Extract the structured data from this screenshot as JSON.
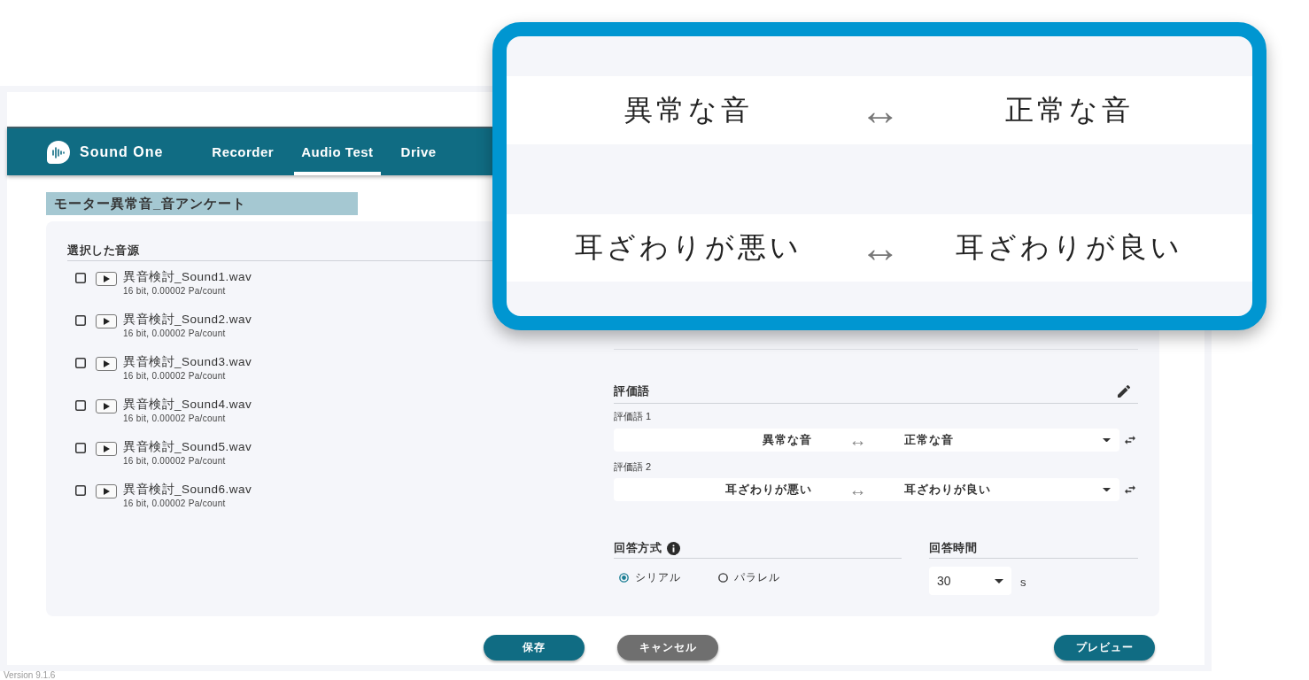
{
  "app": {
    "name": "Sound One"
  },
  "nav_tabs": [
    {
      "label": "Recorder",
      "selected": false
    },
    {
      "label": "Audio Test",
      "selected": true
    },
    {
      "label": "Drive",
      "selected": false
    }
  ],
  "page_title": "モーター異常音_音アンケート",
  "sound_sources": {
    "heading": "選択した音源",
    "items": [
      {
        "name": "異音検討_Sound1.wav",
        "detail": "16 bit, 0.00002 Pa/count",
        "checked": false
      },
      {
        "name": "異音検討_Sound2.wav",
        "detail": "16 bit, 0.00002 Pa/count",
        "checked": false
      },
      {
        "name": "異音検討_Sound3.wav",
        "detail": "16 bit, 0.00002 Pa/count",
        "checked": false
      },
      {
        "name": "異音検討_Sound4.wav",
        "detail": "16 bit, 0.00002 Pa/count",
        "checked": false
      },
      {
        "name": "異音検討_Sound5.wav",
        "detail": "16 bit, 0.00002 Pa/count",
        "checked": false
      },
      {
        "name": "異音検討_Sound6.wav",
        "detail": "16 bit, 0.00002 Pa/count",
        "checked": false
      }
    ]
  },
  "evaluation_words": {
    "heading": "評価語",
    "pairs": [
      {
        "label": "評価語 1",
        "negative": "異常な音",
        "arrow": "↔",
        "positive": "正常な音"
      },
      {
        "label": "評価語 2",
        "negative": "耳ざわりが悪い",
        "arrow": "↔",
        "positive": "耳ざわりが良い"
      }
    ]
  },
  "answer_method": {
    "heading": "回答方式",
    "options": [
      {
        "label": "シリアル",
        "selected": true
      },
      {
        "label": "パラレル",
        "selected": false
      }
    ]
  },
  "answer_time": {
    "heading": "回答時間",
    "value": "30",
    "unit": "s"
  },
  "buttons": [
    {
      "label": "保存",
      "kind": "primary"
    },
    {
      "label": "キャンセル",
      "kind": "secondary"
    }
  ],
  "preview_button": {
    "label": "プレビュー",
    "kind": "primary"
  },
  "zoom_callout": {
    "pairs": [
      {
        "negative": "異常な音",
        "arrow": "↔",
        "positive": "正常な音"
      },
      {
        "negative": "耳ざわりが悪い",
        "arrow": "↔",
        "positive": "耳ざわりが良い"
      }
    ]
  },
  "version": "Version 9.1.6"
}
